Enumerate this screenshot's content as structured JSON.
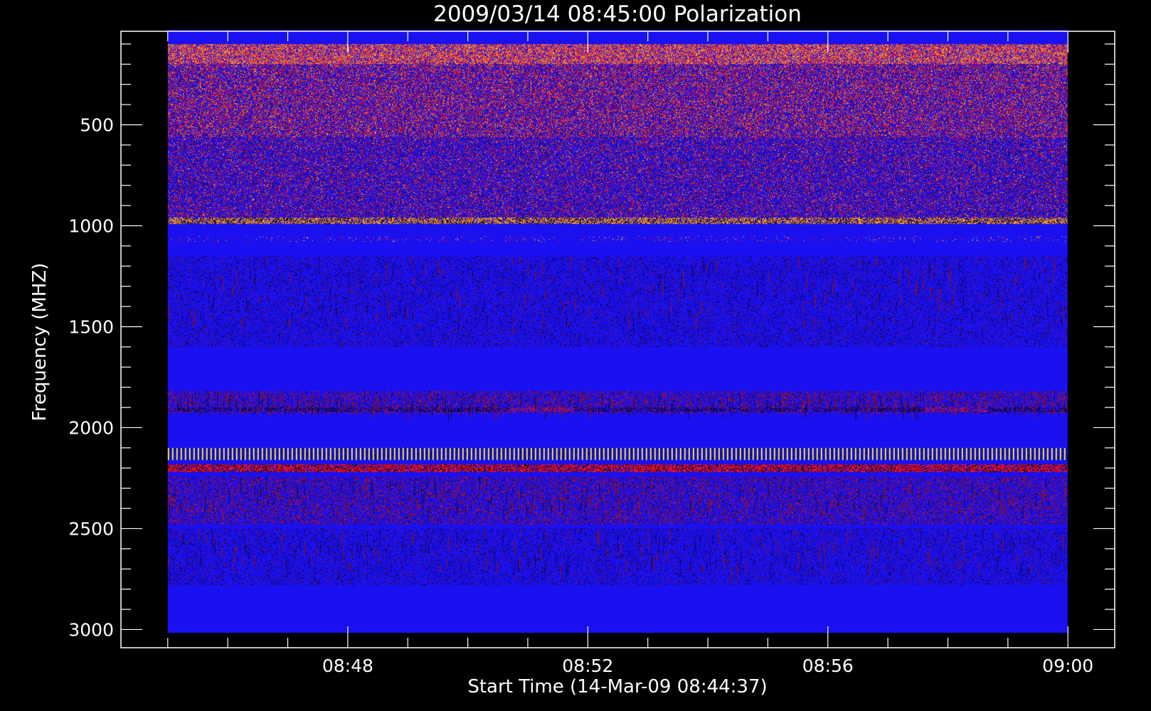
{
  "chart_data": {
    "type": "heatmap",
    "title": "2009/03/14 08:45:00 Polarization",
    "xlabel": "Start Time (14-Mar-09 08:44:37)",
    "ylabel": "Frequency (MHZ)",
    "x_major_ticks": [
      "08:48",
      "08:52",
      "08:56",
      "09:00"
    ],
    "x_major_minutes": [
      48,
      52,
      56,
      60
    ],
    "x_data_range_minutes": [
      45,
      60
    ],
    "x_axis_range_minutes": [
      44.22,
      60.78
    ],
    "y_major_ticks": [
      500,
      1000,
      1500,
      2000,
      2500,
      3000
    ],
    "y_data_range_mhz": [
      30,
      3015
    ],
    "y_axis_range_mhz": [
      37,
      3090
    ],
    "y_reversed": true,
    "colors": {
      "background": "#000000",
      "axes": "#ffffff",
      "base": "#1a10f0",
      "dark_blue": "#0a0870",
      "black": "#000000",
      "red": "#ff1010",
      "dark_red": "#8a1020",
      "purple": "#6a1aa0",
      "orange": "#ff9a30",
      "yellow": "#e8e040"
    },
    "bands": [
      {
        "mhz": [
          100,
          200
        ],
        "pattern": "orange-noise"
      },
      {
        "mhz": [
          200,
          560
        ],
        "pattern": "mixed-noise"
      },
      {
        "mhz": [
          560,
          960
        ],
        "pattern": "blue-noise"
      },
      {
        "mhz": [
          960,
          990
        ],
        "pattern": "orange-line"
      },
      {
        "mhz": [
          1050,
          1080
        ],
        "pattern": "yellow-ticks"
      },
      {
        "mhz": [
          1150,
          1600
        ],
        "pattern": "dark-stripes"
      },
      {
        "mhz": [
          1820,
          1930
        ],
        "pattern": "red-stripes"
      },
      {
        "mhz": [
          1900,
          1920
        ],
        "pattern": "event-line"
      },
      {
        "mhz": [
          2100,
          2160
        ],
        "pattern": "yellow-line"
      },
      {
        "mhz": [
          2180,
          2220
        ],
        "pattern": "red-line"
      },
      {
        "mhz": [
          2240,
          2480
        ],
        "pattern": "red-stripes"
      },
      {
        "mhz": [
          2500,
          2780
        ],
        "pattern": "dark-stripes"
      }
    ]
  }
}
